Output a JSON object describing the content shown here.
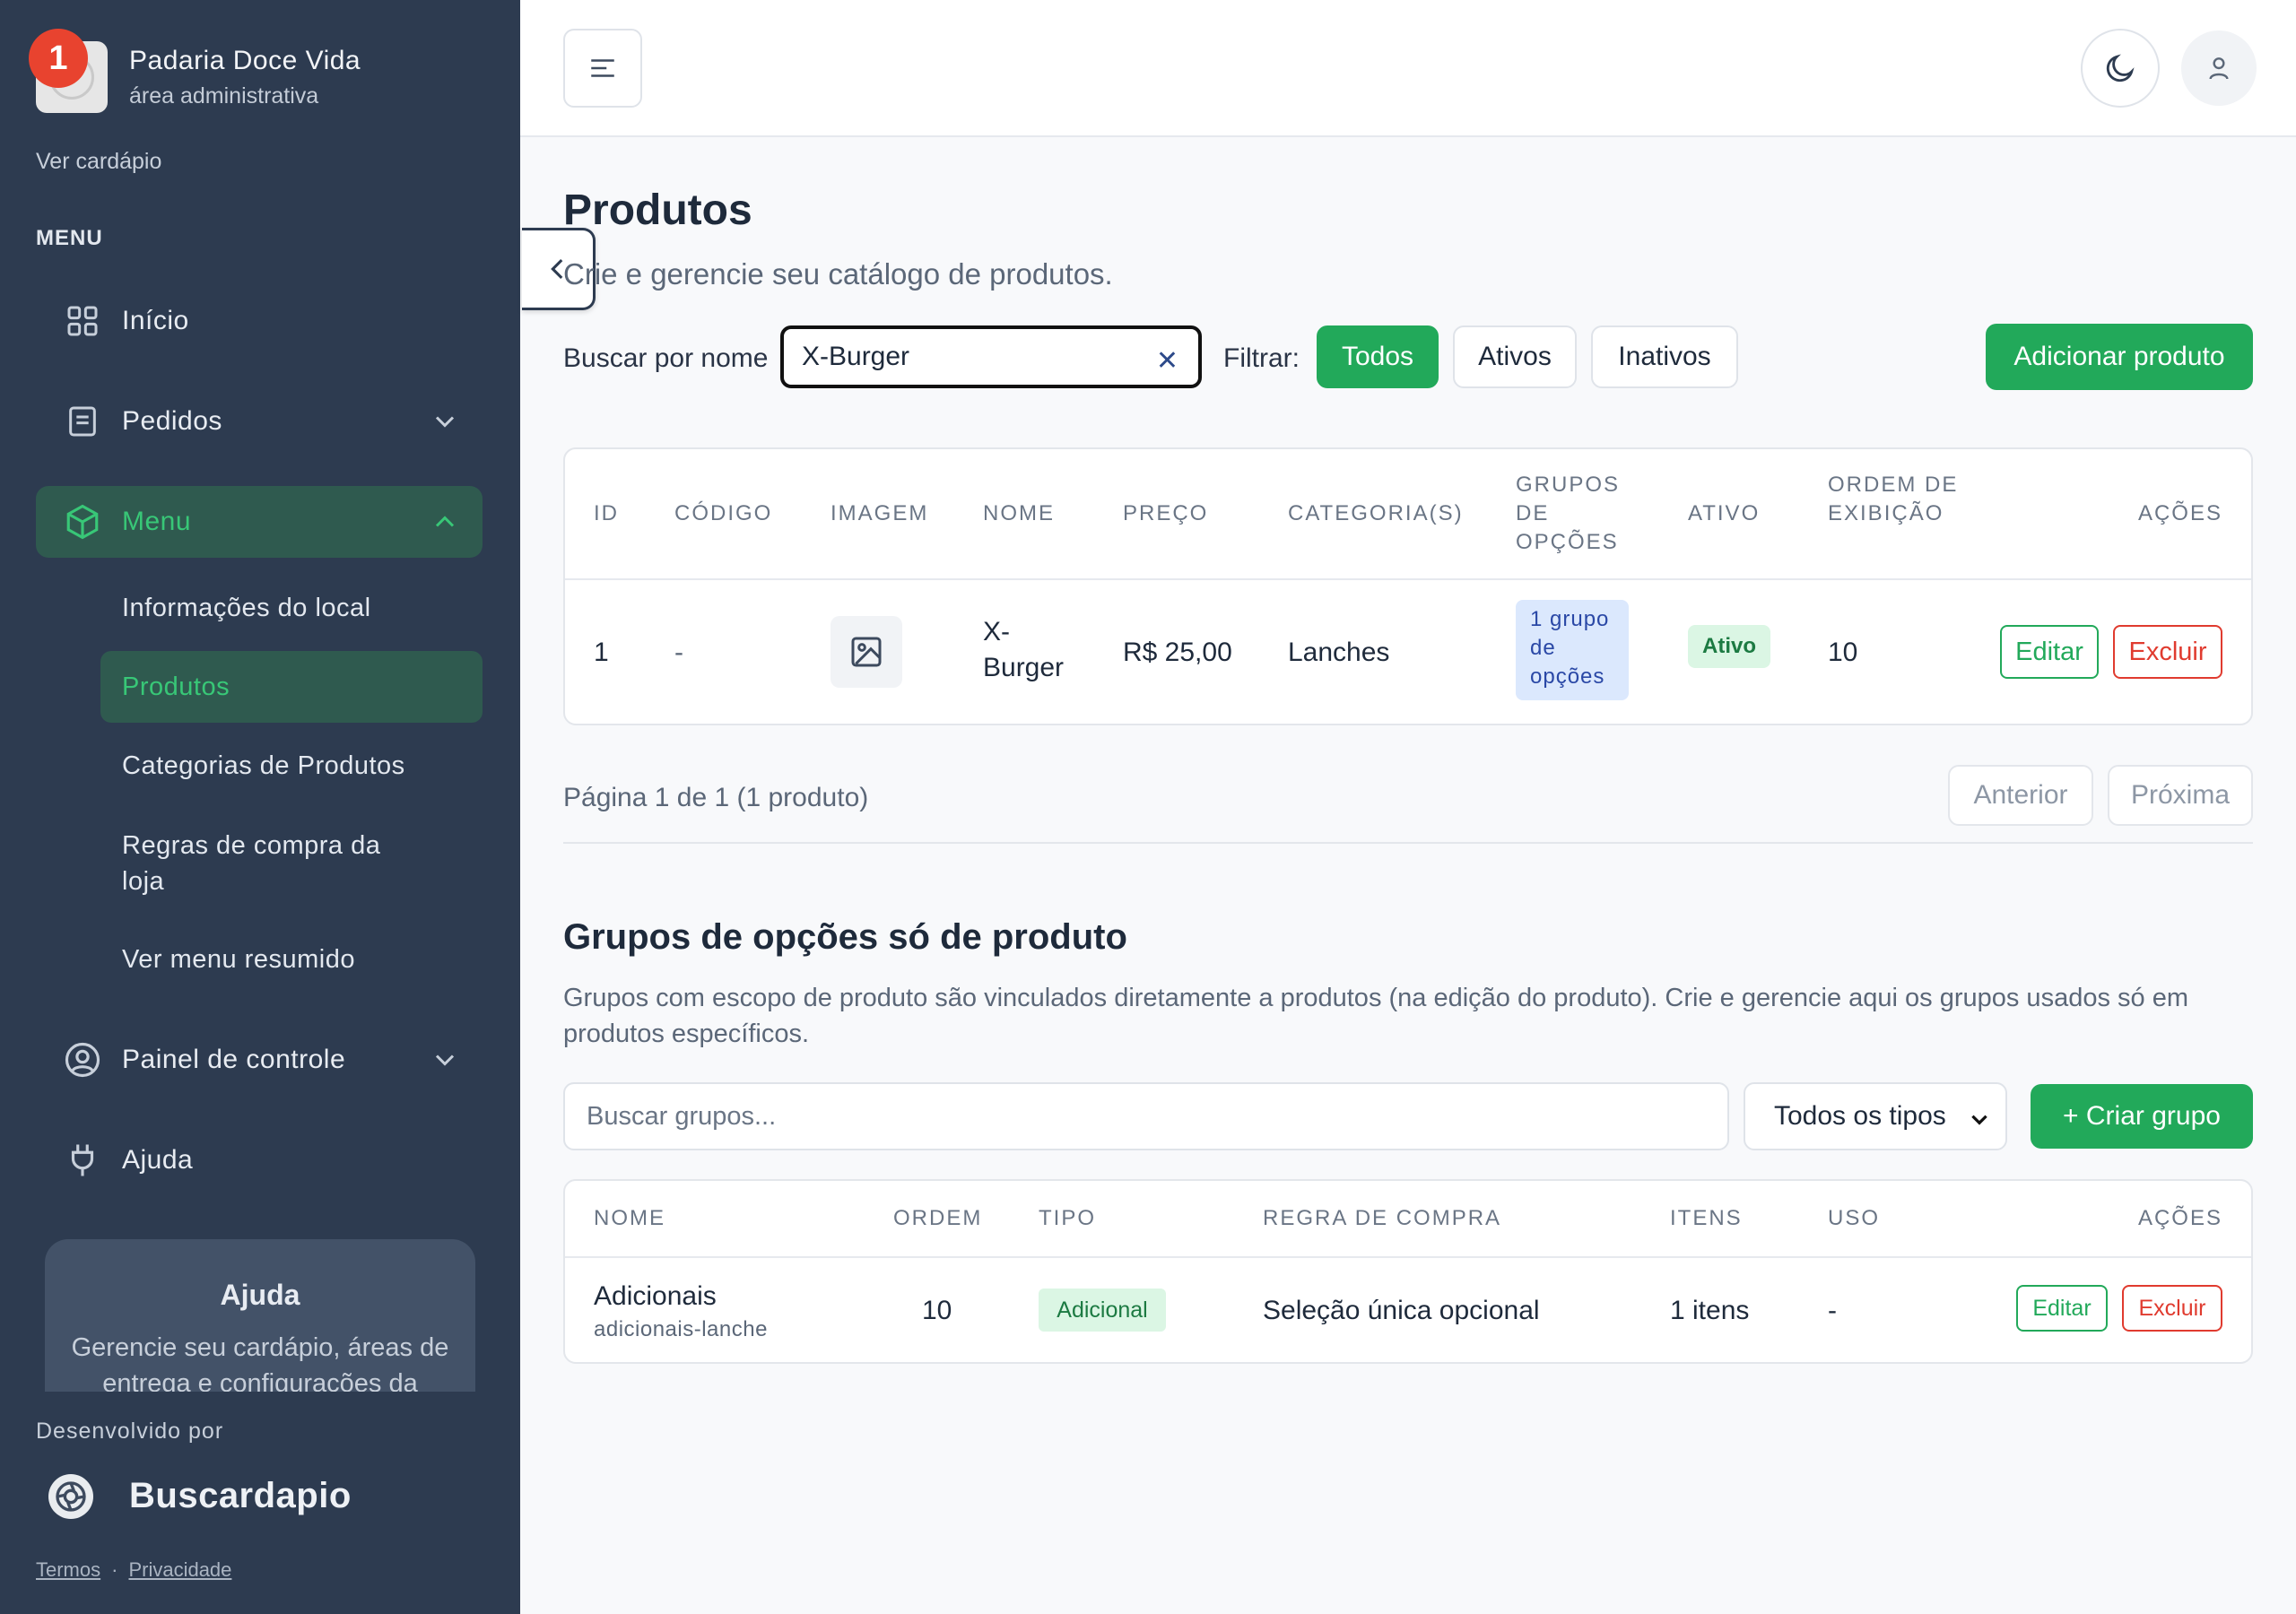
{
  "sidebar": {
    "notification_count": "1",
    "brand_name": "Padaria Doce Vida",
    "brand_sub": "área administrativa",
    "view_menu_link": "Ver cardápio",
    "menu_section_label": "MENU",
    "nav": {
      "inicio": "Início",
      "pedidos": "Pedidos",
      "menu": "Menu",
      "painel": "Painel de controle",
      "ajuda": "Ajuda"
    },
    "sub_items": {
      "info_local": "Informações do local",
      "produtos": "Produtos",
      "categorias": "Categorias de Produtos",
      "regras": "Regras de compra da loja",
      "menu_resumido": "Ver menu resumido"
    },
    "help_card": {
      "title": "Ajuda",
      "text": "Gerencie seu cardápio, áreas de entrega e configurações da"
    },
    "developed_by": "Desenvolvido por",
    "developer_name": "Buscardapio",
    "terms_link": "Termos",
    "privacy_link": "Privacidade",
    "link_separator": "·"
  },
  "header": {},
  "products": {
    "title": "Produtos",
    "subtitle": "Crie e gerencie seu catálogo de produtos.",
    "search_label": "Buscar por nome",
    "search_value": "X-Burger",
    "filter_label": "Filtrar:",
    "filters": {
      "all": "Todos",
      "active": "Ativos",
      "inactive": "Inativos"
    },
    "add_button": "Adicionar produto",
    "columns": {
      "id": "ID",
      "code": "CÓDIGO",
      "image": "IMAGEM",
      "name": "NOME",
      "price": "PREÇO",
      "categories": "CATEGORIA(S)",
      "option_groups": "GRUPOS DE OPÇÕES",
      "active": "ATIVO",
      "display_order": "ORDEM DE EXIBIÇÃO",
      "actions": "AÇÕES"
    },
    "rows": [
      {
        "id": "1",
        "code": "-",
        "name": "X-Burger",
        "price": "R$ 25,00",
        "categories": "Lanches",
        "option_groups": "1 grupo de opções",
        "active": "Ativo",
        "display_order": "10",
        "edit": "Editar",
        "delete": "Excluir"
      }
    ],
    "pagination": {
      "info": "Página 1 de 1 (1 produto)",
      "prev": "Anterior",
      "next": "Próxima"
    }
  },
  "option_groups": {
    "title": "Grupos de opções só de produto",
    "description": "Grupos com escopo de produto são vinculados diretamente a produtos (na edição do produto). Crie e gerencie aqui os grupos usados só em produtos específicos.",
    "search_placeholder": "Buscar grupos...",
    "type_select_value": "Todos os tipos",
    "create_button": "+ Criar grupo",
    "columns": {
      "name": "NOME",
      "order": "ORDEM",
      "type": "TIPO",
      "rule": "REGRA DE COMPRA",
      "items": "ITENS",
      "usage": "USO",
      "actions": "AÇÕES"
    },
    "rows": [
      {
        "name": "Adicionais",
        "slug": "adicionais-lanche",
        "order": "10",
        "type": "Adicional",
        "rule": "Seleção única opcional",
        "items": "1 itens",
        "usage": "-",
        "edit": "Editar",
        "delete": "Excluir"
      }
    ]
  },
  "colors": {
    "sidebar_bg": "#2d3b50",
    "accent_green": "#22a95a",
    "danger_red": "#e03b2f",
    "active_nav_bg": "#2f5a4f"
  }
}
